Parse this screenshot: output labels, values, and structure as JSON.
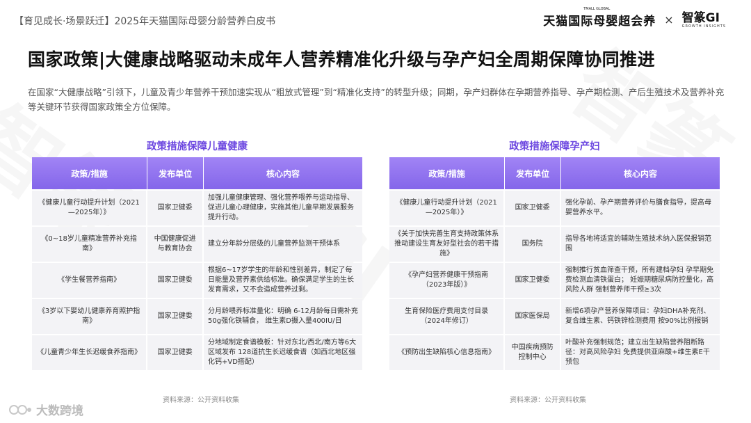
{
  "header": {
    "report_title": "【育见成长·场景跃迁】2025年天猫国际母婴分龄营养白皮书",
    "logo_tmall": "天猫国际母婴超会养",
    "logo_tmall_sub": "TMALL GLOBAL",
    "times_sign": "×",
    "logo_zg": "智篆GI",
    "logo_zg_tag": "GROWTH INSIGHTS"
  },
  "page_title": "国家政策|大健康战略驱动未成年人营养精准化升级与孕产妇全周期保障协同推进",
  "intro": "在国家“大健康战略”引领下，儿童及青少年营养干预加速实现从“粗放式管理”到“精准化支持”的转型升级；同期，孕产妇群体在孕期营养指导、孕产期检测、产后生殖技术及营养补充等关键环节获得国家政策全方位保障。",
  "tables": {
    "children": {
      "title": "政策措施保障儿童健康",
      "headers": [
        "政策/措施",
        "发布单位",
        "核心内容"
      ],
      "rows": [
        [
          "《健康儿童行动提升计划（2021—2025年）》",
          "国家卫健委",
          "加强儿童健康管理、强化营养喂养与运动指导、促进儿童心理健康，实施其他儿童早期发展服务提升行动。"
        ],
        [
          "《0~18岁儿童精准营养补充指南》",
          "中国健康促进与教育协会",
          "建立分年龄分层级的儿童营养监测干预体系"
        ],
        [
          "《学生餐营养指南》",
          "国家卫健委",
          "根据6~17岁学生的年龄和性别差异，制定了每日能量及营养素供给标准。确保满足学生的生长发育需求，又不会造成营养过剩。"
        ],
        [
          "《3岁以下婴幼儿健康养育照护指南》",
          "国家卫健委",
          "分月龄喂养标准量化：明确 6-12月龄每日需补充50g强化铁辅食， 维生素D摄入量400IU/日"
        ],
        [
          "《儿童青少年生长迟缓食养指南》",
          "国家卫健委",
          "分地域制定食谱模板：针对东北/西北/南方等6大区域发布 128道抗生长迟缓食谱（如西北地区强化钙+VD搭配）"
        ]
      ]
    },
    "mothers": {
      "title": "政策措施保障孕产妇",
      "headers": [
        "政策/措施",
        "发布单位",
        "核心内容"
      ],
      "rows": [
        [
          "《健康儿童行动提升计划（2021—2025年）》",
          "国家卫健委",
          "强化孕前、孕产期营养评价与膳食指导，提高母婴营养水平。"
        ],
        [
          "《关于加快完善生育支持政策体系推动建设生育友好型社会的若干措施》",
          "国务院",
          "指导各地将适宜的辅助生殖技术纳入医保报销范围"
        ],
        [
          "《孕产妇营养健康干预指南（2023年版）》",
          "国家卫健委",
          "强制推行贫血筛查干预，所有建档孕妇 孕早期免费检测血清铁蛋白； 妊娠期糖尿病防控量化，高风险人群 强制营养师干预≥3次"
        ],
        [
          "生育保险医疗费用支付目录（2024年修订）",
          "国家医保局",
          "新增6项孕产营养保障项目：孕妇DHA补充剂、复合维生素、钙铁锌检测费用 按90%比例报销"
        ],
        [
          "《预防出生缺陷核心信息指南》",
          "中国疾病预防控制中心",
          "叶酸补充强制规范；建立出生缺陷营养阻断路径：对高风险孕妇 免费提供亚麻酸+维生素E干预包"
        ]
      ]
    }
  },
  "source_left": "资料来源：公开资料收集",
  "source_right": "资料来源：公开资料收集",
  "footer_brand": "大数跨境",
  "colors": {
    "accent": "#8466ea",
    "title_purple": "#6b46e0",
    "row_bg": "#f3f3f6"
  }
}
